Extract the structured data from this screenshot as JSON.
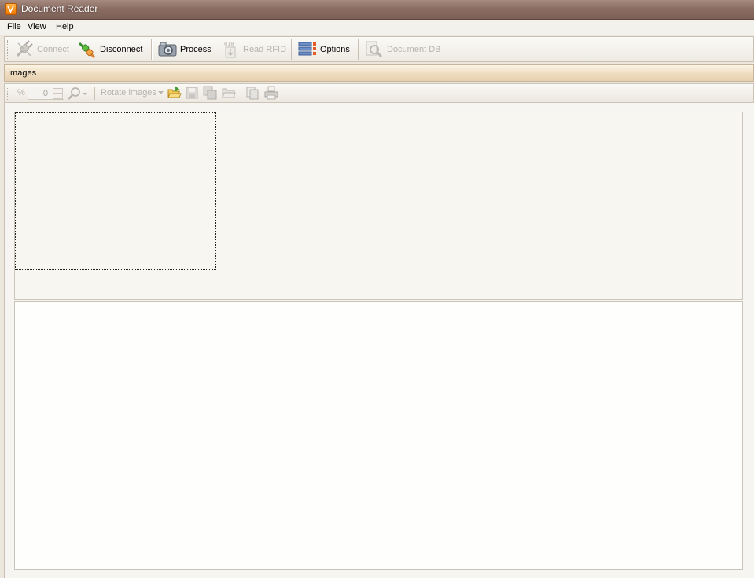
{
  "window": {
    "title": "Document Reader"
  },
  "menu": {
    "file": "File",
    "view": "View",
    "help": "Help"
  },
  "toolbar": {
    "connect": "Connect",
    "disconnect": "Disconnect",
    "process": "Process",
    "read_rfid": "Read RFID",
    "options": "Options",
    "document_db": "Document DB"
  },
  "images_panel": {
    "title": "Images",
    "zoom_percent_label": "%",
    "zoom_value": "0",
    "rotate_label": "Rotate images"
  },
  "colors": {
    "title_bar": "#8b6d63",
    "panel_header": "#efdcc0",
    "accent_orange": "#f07800"
  }
}
